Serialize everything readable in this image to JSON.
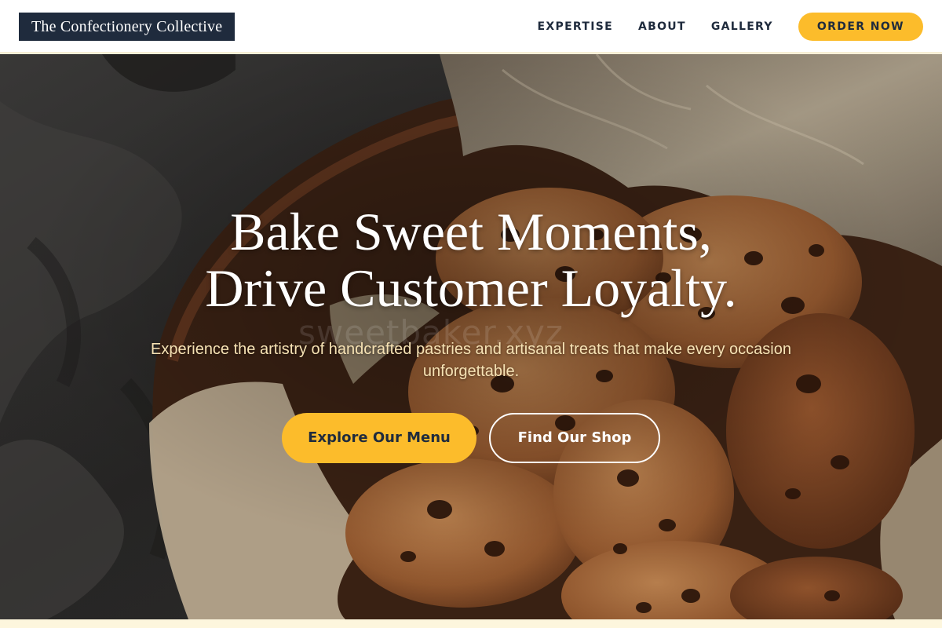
{
  "header": {
    "logo_text": "The Confectionery Collective",
    "nav": [
      "EXPERTISE",
      "ABOUT",
      "GALLERY"
    ],
    "order_button": "ORDER NOW"
  },
  "hero": {
    "title_line_1": "Bake Sweet Moments,",
    "title_line_2": "Drive Customer Loyalty.",
    "subtitle": "Experience the artistry of handcrafted pastries and artisanal treats that make every occasion unforgettable.",
    "primary_button": "Explore Our Menu",
    "secondary_button": "Find Our Shop",
    "watermark": "sweetbaker.xyz",
    "image_subject": "chocolate chip cookies in a basket lined with parchment paper"
  },
  "colors": {
    "accent": "#fcbc2b",
    "navy": "#1f2b3d",
    "white": "#ffffff"
  }
}
